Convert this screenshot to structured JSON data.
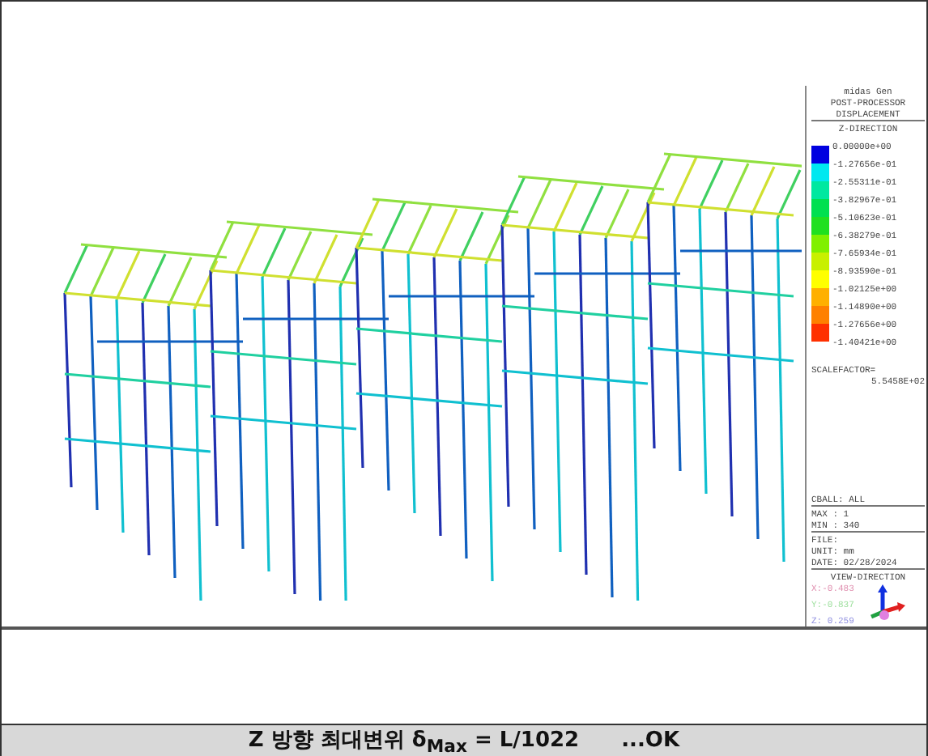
{
  "legend": {
    "program": "midas Gen",
    "module": "POST-PROCESSOR",
    "result": "DISPLACEMENT",
    "component": "Z-DIRECTION",
    "values": [
      "0.00000e+00",
      "-1.27656e-01",
      "-2.55311e-01",
      "-3.82967e-01",
      "-5.10623e-01",
      "-6.38279e-01",
      "-7.65934e-01",
      "-8.93590e-01",
      "-1.02125e+00",
      "-1.14890e+00",
      "-1.27656e+00",
      "-1.40421e+00"
    ],
    "bands": [
      {
        "color": "#0000e0"
      },
      {
        "color": "#00e8f0"
      },
      {
        "color": "#00e8a0"
      },
      {
        "color": "#00e050"
      },
      {
        "color": "#20e020"
      },
      {
        "color": "#80f000"
      },
      {
        "color": "#c8f000"
      },
      {
        "color": "#ffff00"
      },
      {
        "color": "#ffb000"
      },
      {
        "color": "#ff8000"
      },
      {
        "color": "#ff3000"
      }
    ],
    "scale_label": "SCALEFACTOR=",
    "scale_value": "5.5458E+02",
    "cball": "CBALL: ALL",
    "max": "MAX : 1",
    "min": "MIN : 340",
    "file": "FILE:",
    "unit": "UNIT: mm",
    "date": "DATE: 02/28/2024",
    "view_title": "VIEW-DIRECTION",
    "view": [
      {
        "text": "X:-0.483",
        "color": "#e090b0"
      },
      {
        "text": "Y:-0.837",
        "color": "#a0e0a0"
      },
      {
        "text": "Z: 0.259",
        "color": "#9090e0"
      }
    ]
  },
  "caption": {
    "text": "Z 방향 최대변위 δ$_{Max}$ = L/1022",
    "result": "...OK"
  }
}
